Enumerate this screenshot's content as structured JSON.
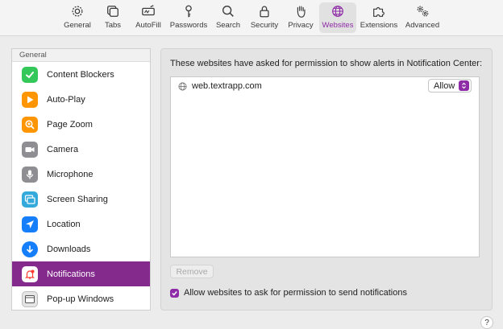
{
  "toolbar": {
    "items": [
      {
        "label": "General",
        "icon": "gear-icon"
      },
      {
        "label": "Tabs",
        "icon": "tabs-icon"
      },
      {
        "label": "AutoFill",
        "icon": "autofill-icon"
      },
      {
        "label": "Passwords",
        "icon": "key-icon"
      },
      {
        "label": "Search",
        "icon": "magnifier-icon"
      },
      {
        "label": "Security",
        "icon": "lock-icon"
      },
      {
        "label": "Privacy",
        "icon": "hand-icon"
      },
      {
        "label": "Websites",
        "icon": "globe-icon",
        "active": true
      },
      {
        "label": "Extensions",
        "icon": "puzzle-icon"
      },
      {
        "label": "Advanced",
        "icon": "gears-icon"
      }
    ]
  },
  "sidebar": {
    "header": "General",
    "items": [
      {
        "label": "Content Blockers",
        "icon": "checkmark-icon",
        "color": "#34c759"
      },
      {
        "label": "Auto-Play",
        "icon": "play-icon",
        "color": "#ff9500"
      },
      {
        "label": "Page Zoom",
        "icon": "zoom-icon",
        "color": "#ff9500"
      },
      {
        "label": "Camera",
        "icon": "camera-icon",
        "color": "#8e8e93"
      },
      {
        "label": "Microphone",
        "icon": "microphone-icon",
        "color": "#8e8e93"
      },
      {
        "label": "Screen Sharing",
        "icon": "screen-sharing-icon",
        "color": "#34aadc"
      },
      {
        "label": "Location",
        "icon": "location-arrow-icon",
        "color": "#147efb"
      },
      {
        "label": "Downloads",
        "icon": "download-icon",
        "color": "#147efb"
      },
      {
        "label": "Notifications",
        "icon": "notification-bell-icon",
        "color": "#ff3b30",
        "active": true
      },
      {
        "label": "Pop-up Windows",
        "icon": "popup-window-icon",
        "color": "#8e8e93"
      }
    ]
  },
  "main": {
    "title": "These websites have asked for permission to show alerts in Notification Center:",
    "sites": [
      {
        "name": "web.textrapp.com",
        "permission": "Allow"
      }
    ],
    "remove_label": "Remove",
    "checkbox_label": "Allow websites to ask for permission to send notifications",
    "checkbox_checked": true
  },
  "help_label": "?",
  "accent_color": "#8e2ba6"
}
